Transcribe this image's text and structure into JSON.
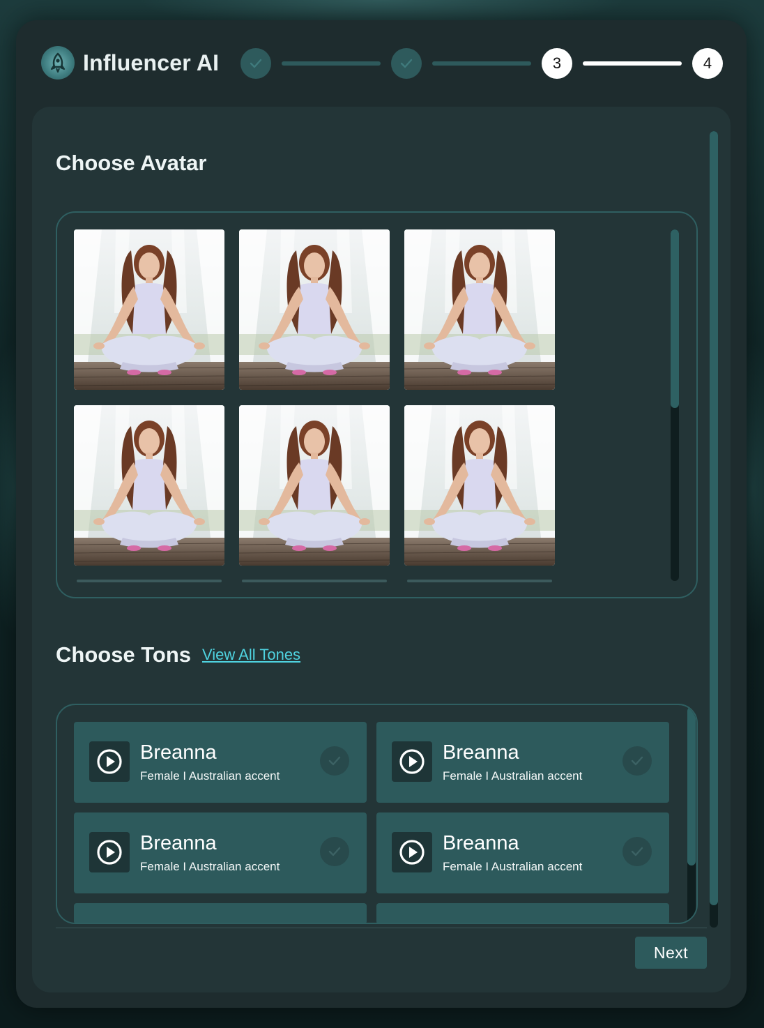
{
  "app": {
    "title": "Influencer AI"
  },
  "stepper": {
    "steps": [
      {
        "state": "done",
        "label": ""
      },
      {
        "state": "done",
        "label": ""
      },
      {
        "state": "active",
        "label": "3"
      },
      {
        "state": "active",
        "label": "4"
      }
    ]
  },
  "avatar_section": {
    "title": "Choose Avatar",
    "avatars": [
      {
        "alt": ""
      },
      {
        "alt": ""
      },
      {
        "alt": ""
      },
      {
        "alt": ""
      },
      {
        "alt": ""
      },
      {
        "alt": ""
      }
    ]
  },
  "tones_section": {
    "title": "Choose Tons",
    "view_all_label": "View All Tones",
    "tones": [
      {
        "name": "Breanna",
        "description": "Female I Australian accent"
      },
      {
        "name": "Breanna",
        "description": "Female I Australian accent"
      },
      {
        "name": "Breanna",
        "description": "Female I Australian accent"
      },
      {
        "name": "Breanna",
        "description": "Female I Australian accent"
      }
    ]
  },
  "footer": {
    "next_label": "Next"
  },
  "colors": {
    "accent": "#2d5a5c",
    "link": "#4fd3e0",
    "panel": "#233537",
    "window": "#1e2c2e"
  },
  "icons": {
    "logo": "rocket-icon",
    "step_done": "check-icon",
    "tone_play": "play-icon",
    "tone_check": "check-icon"
  }
}
